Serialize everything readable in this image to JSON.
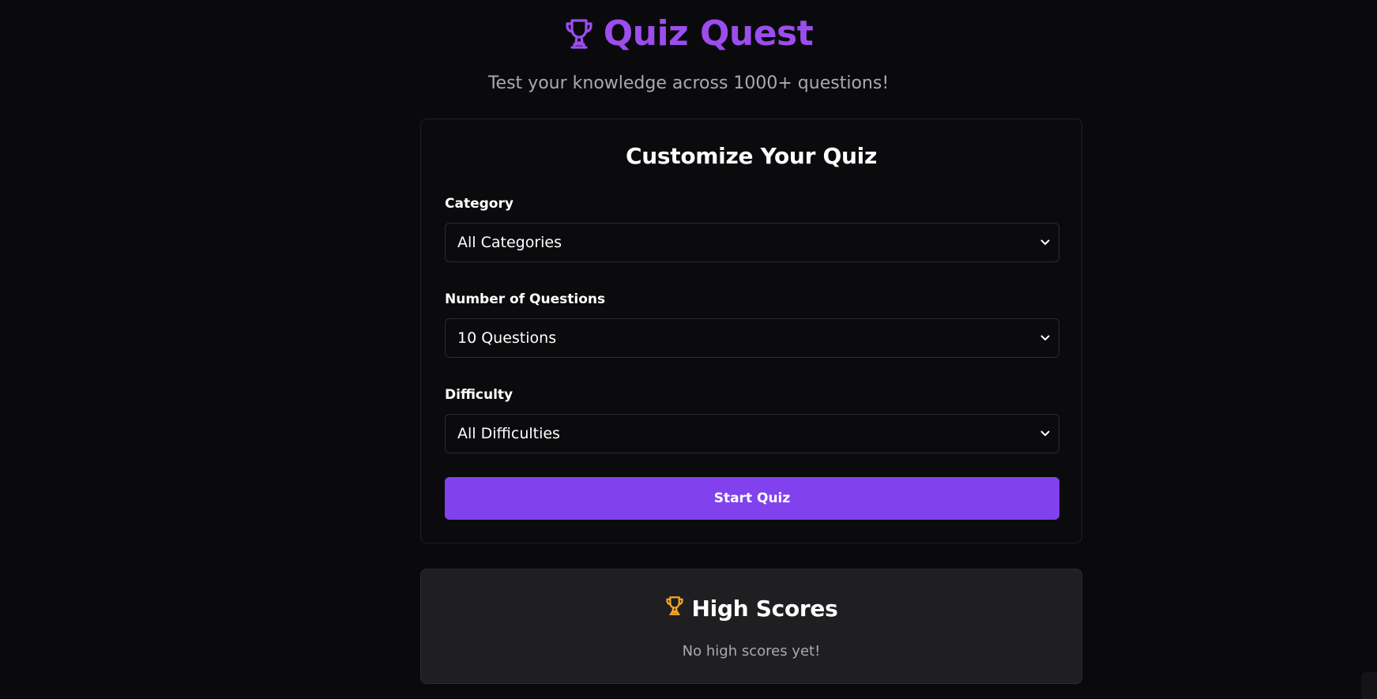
{
  "app": {
    "title": "Quiz Quest",
    "subtitle": "Test your knowledge across 1000+ questions!",
    "icon": "trophy-icon",
    "accent_color": "#9b4dee"
  },
  "customize": {
    "title": "Customize Your Quiz",
    "fields": [
      {
        "label": "Category",
        "value": "All Categories"
      },
      {
        "label": "Number of Questions",
        "value": "10 Questions"
      },
      {
        "label": "Difficulty",
        "value": "All Difficulties"
      }
    ],
    "start_label": "Start Quiz",
    "button_color": "#8142ee"
  },
  "high_scores": {
    "title": "High Scores",
    "icon": "trophy-icon",
    "icon_color": "#f5a623",
    "empty_text": "No high scores yet!"
  }
}
